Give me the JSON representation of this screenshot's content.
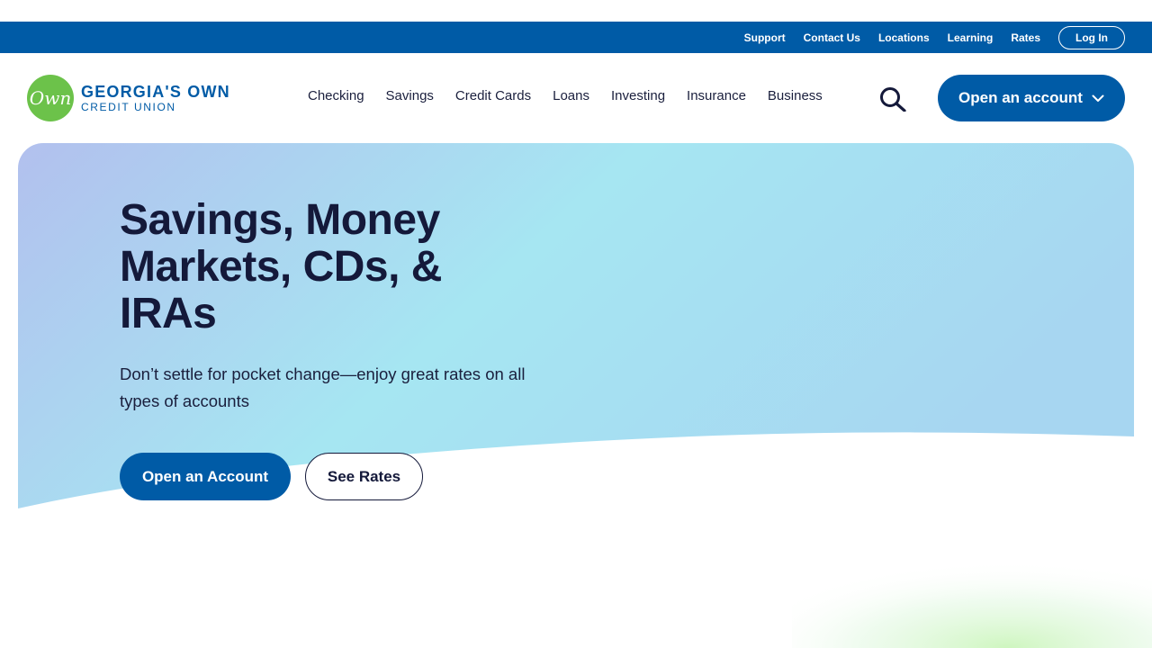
{
  "utility_nav": {
    "links": [
      "Support",
      "Contact Us",
      "Locations",
      "Learning",
      "Rates"
    ],
    "login_label": "Log In"
  },
  "logo": {
    "mark": "Own",
    "line1": "GEORGIA'S OWN",
    "line2": "CREDIT UNION"
  },
  "primary_nav": {
    "items": [
      "Checking",
      "Savings",
      "Credit Cards",
      "Loans",
      "Investing",
      "Insurance",
      "Business"
    ],
    "search_icon": "search-icon",
    "open_account_label": "Open an account",
    "open_account_icon": "chevron-down-icon"
  },
  "hero": {
    "title": "Savings, Money Markets, CDs, & IRAs",
    "subtitle": "Don’t settle for pocket change—enjoy great rates on all types of accounts",
    "primary_button": "Open an Account",
    "secondary_button": "See Rates"
  },
  "colors": {
    "brand_blue": "#005ba6",
    "brand_green": "#6cc24a",
    "heading": "#14193a"
  }
}
